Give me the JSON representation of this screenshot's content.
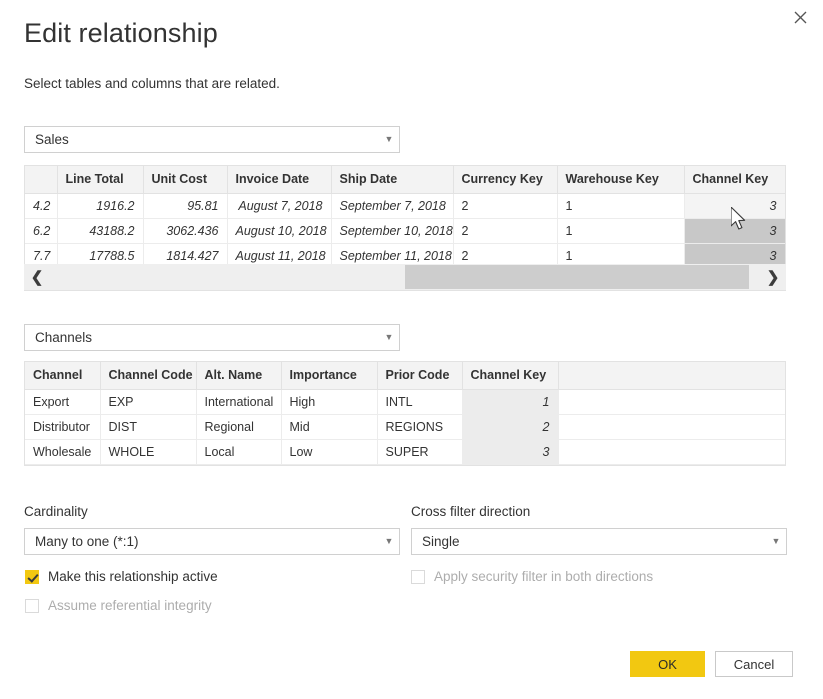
{
  "dialog": {
    "title": "Edit relationship",
    "subtitle": "Select tables and columns that are related.",
    "close_icon": "close-icon"
  },
  "accent_color": "#f2c811",
  "selected_column_color": "#c8c8c8",
  "sales": {
    "select_value": "Sales",
    "columns": [
      "",
      "Line Total",
      "Unit Cost",
      "Invoice Date",
      "Ship Date",
      "Currency Key",
      "Warehouse Key",
      "Channel Key"
    ],
    "selected_column": "Channel Key",
    "rows": [
      [
        "4.2",
        "1916.2",
        "95.81",
        "August 7, 2018",
        "September 7, 2018",
        "2",
        "1",
        "3"
      ],
      [
        "6.2",
        "43188.2",
        "3062.436",
        "August 10, 2018",
        "September 10, 2018",
        "2",
        "1",
        "3"
      ],
      [
        "7.7",
        "17788.5",
        "1814.427",
        "August 11, 2018",
        "September 11, 2018",
        "2",
        "1",
        "3"
      ]
    ],
    "scroll": {
      "left_arrow": "chevron-left-icon",
      "right_arrow": "chevron-right-icon"
    }
  },
  "channels": {
    "select_value": "Channels",
    "columns": [
      "Channel",
      "Channel Code",
      "Alt. Name",
      "Importance",
      "Prior Code",
      "Channel Key"
    ],
    "selected_column": "Channel Key",
    "rows": [
      [
        "Export",
        "EXP",
        "International",
        "High",
        "INTL",
        "1"
      ],
      [
        "Distributor",
        "DIST",
        "Regional",
        "Mid",
        "REGIONS",
        "2"
      ],
      [
        "Wholesale",
        "WHOLE",
        "Local",
        "Low",
        "SUPER",
        "3"
      ]
    ]
  },
  "options": {
    "cardinality_label": "Cardinality",
    "cardinality_value": "Many to one (*:1)",
    "crossfilter_label": "Cross filter direction",
    "crossfilter_value": "Single",
    "make_active_label": "Make this relationship active",
    "make_active_checked": true,
    "referential_integrity_label": "Assume referential integrity",
    "referential_integrity_checked": false,
    "security_filter_label": "Apply security filter in both directions",
    "security_filter_checked": false
  },
  "footer": {
    "ok_label": "OK",
    "cancel_label": "Cancel"
  }
}
